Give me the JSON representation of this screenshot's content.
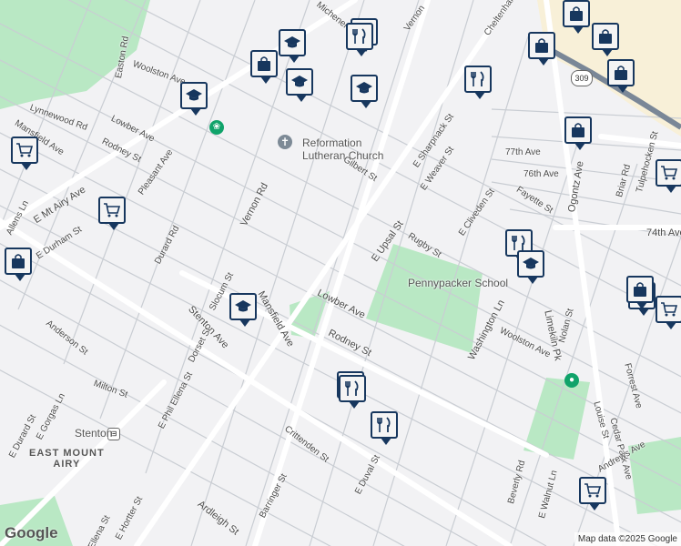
{
  "map": {
    "credit": "Map data ©2025 Google",
    "logo": "Google",
    "route_shield": "309",
    "colors": {
      "park": "#b9e8c4",
      "road": "#ffffff",
      "street_line": "#c9cdd3",
      "commercial": "#f8f0d8",
      "marker_border": "#17375e",
      "highway": "#7a8797"
    }
  },
  "places": {
    "neighborhood": "EAST MOUNT\nAIRY",
    "station": "Stenton",
    "church": "Reformation\nLutheran Church",
    "school": "Pennypacker School"
  },
  "streets": [
    "Lowber Ave",
    "Rugby St",
    "Gilbert St",
    "Vernon Rd",
    "E Upsal St",
    "Stenton Ave",
    "Mansfield Ave",
    "Rodney St",
    "Woolston Ave",
    "Washington Ln",
    "Limekiln Pk",
    "Ogontz Ave",
    "E Sharpnack St",
    "E Weaver St",
    "E Cliveden St",
    "74th Ave",
    "76th Ave",
    "77th Ave",
    "Fayette St",
    "Nolan St",
    "Louise St",
    "Forrest Ave",
    "Cedar Park Ave",
    "Beverly Rd",
    "E Walnut Ln",
    "Crittenden St",
    "Barringer St",
    "Ardleigh St",
    "E Duval St",
    "Milton St",
    "Anderson St",
    "E Phil Ellena St",
    "Dorset St",
    "Slocum St",
    "Durard Rd",
    "E Mt Airy Ave",
    "Lynnewood Rd",
    "Easton Rd",
    "E Durham St",
    "Pleasant Ave",
    "Mansfield Ave",
    "Allens Ln",
    "E Gorgas Ln",
    "E Durard St",
    "E Hortter St",
    "Tulpehocken St",
    "Briar Rd",
    "Cheltenham Ave",
    "Michener",
    "Vernon",
    "Woolston Ave",
    "Andrews Ave",
    "Ellena St",
    "Lowber Ave",
    "Rodney St"
  ],
  "markers": [
    {
      "kind": "school"
    },
    {
      "kind": "shopping"
    },
    {
      "kind": "school"
    },
    {
      "kind": "school"
    },
    {
      "kind": "restaurant"
    },
    {
      "kind": "restaurant"
    },
    {
      "kind": "school"
    },
    {
      "kind": "restaurant"
    },
    {
      "kind": "shopping"
    },
    {
      "kind": "shopping"
    },
    {
      "kind": "shopping"
    },
    {
      "kind": "shopping"
    },
    {
      "kind": "shopping"
    },
    {
      "kind": "grocery"
    },
    {
      "kind": "grocery"
    },
    {
      "kind": "shopping"
    },
    {
      "kind": "school"
    },
    {
      "kind": "restaurant"
    },
    {
      "kind": "restaurant"
    },
    {
      "kind": "restaurant"
    },
    {
      "kind": "restaurant"
    },
    {
      "kind": "school"
    },
    {
      "kind": "grocery"
    },
    {
      "kind": "shopping"
    },
    {
      "kind": "grocery"
    },
    {
      "kind": "grocery"
    },
    {
      "kind": "grocery"
    }
  ]
}
